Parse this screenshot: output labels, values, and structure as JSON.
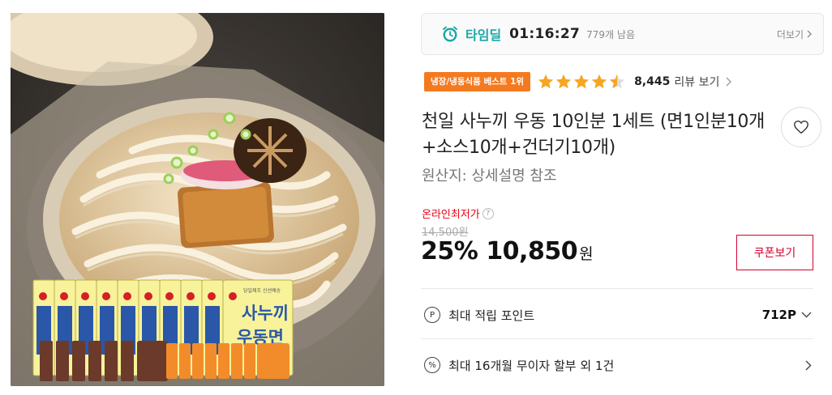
{
  "timedeal": {
    "label": "타임딜",
    "time": "01:16:27",
    "remaining": "779개 남음",
    "more": "더보기",
    "icon": "alarm-clock-icon",
    "accent": "#1ba8a8"
  },
  "rating": {
    "badge": "냉장/냉동식품 베스트 1위",
    "badge_color": "#f47a20",
    "stars": 4.5,
    "star_color": "#f5a623",
    "review_count": "8,445",
    "review_label": "리뷰 보기"
  },
  "product": {
    "title": "천일 사누끼 우동 10인분 1세트 (면1인분10개+소스10개+건더기10개)",
    "origin": "원산지: 상세설명 참조",
    "image_icon": "udon-bowl-photo"
  },
  "package": {
    "small_print": "당일제조 신선배송",
    "name_line1": "사누끼",
    "name_line2": "우동면"
  },
  "price": {
    "label": "온라인최저가",
    "help_symbol": "?",
    "original": "14,500원",
    "discount": "25%",
    "sale": "10,850",
    "currency": "원",
    "accent": "#e60012"
  },
  "coupon": {
    "label": "쿠폰보기"
  },
  "info": {
    "points": {
      "icon_text": "P",
      "label": "최대 적립 포인트",
      "value": "712P"
    },
    "installment": {
      "icon_text": "%",
      "label": "최대 16개월 무이자 할부 외 1건"
    }
  }
}
